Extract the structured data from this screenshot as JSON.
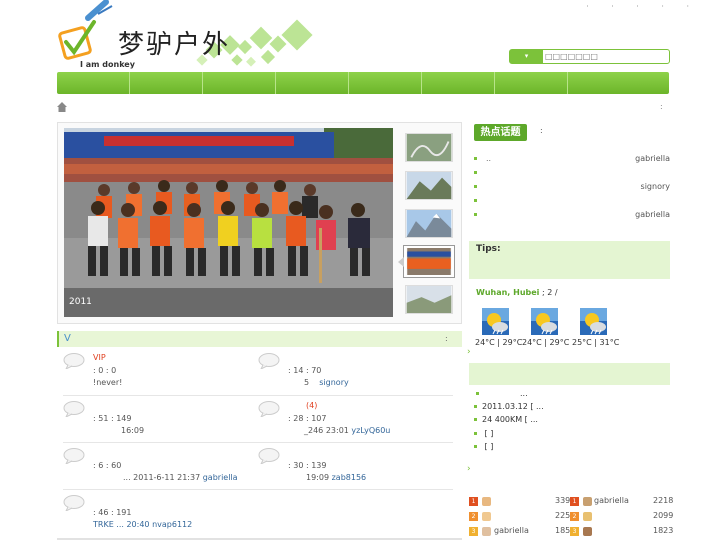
{
  "header": {
    "logo_en": "I am donkey",
    "logo_zh": "梦驴户外",
    "top_dots": "· · · · ·"
  },
  "search": {
    "button_label": "▾",
    "placeholder": "□□□□□□□"
  },
  "nav": {
    "items": [
      "",
      "",
      "",
      "",
      "",
      "",
      "",
      ""
    ]
  },
  "breadcrumb": {
    "right": ":"
  },
  "slideshow": {
    "caption": "2011",
    "thumb_count": 5,
    "active_thumb": 3
  },
  "forum": {
    "bar_left": "V",
    "bar_right": ":",
    "items": [
      {
        "title": "VIP",
        "stats": ": 0    : 0",
        "meta": "!never!",
        "meta_user": ""
      },
      {
        "title": "",
        "stats": ": 14    : 70",
        "meta": "5",
        "meta_user": "signory"
      },
      {
        "title": "",
        "stats": ": 51    : 149",
        "meta": "16:09",
        "meta_user": ""
      },
      {
        "title": "(4)",
        "stats": ": 28    : 107",
        "meta": "_246     23:01",
        "meta_user": "yzLyQ60u"
      },
      {
        "title": "",
        "stats": ": 6    : 60",
        "meta": "... 2011-6-11 21:37",
        "meta_user": "gabriella"
      },
      {
        "title": "",
        "stats": ": 30    : 139",
        "meta": "19:09",
        "meta_user": "zab8156"
      },
      {
        "title": "",
        "stats": ": 46    : 191",
        "meta": "TRKE              ...     20:40",
        "meta_user": "nvap6112"
      }
    ]
  },
  "hot": {
    "badge": "热点话题",
    "colon": ":",
    "items": [
      {
        "title": "..",
        "author": "gabriella"
      },
      {
        "title": "",
        "author": ""
      },
      {
        "title": "",
        "author": "signory"
      },
      {
        "title": "",
        "author": ""
      },
      {
        "title": "",
        "author": "gabriella"
      }
    ]
  },
  "tips": {
    "label": "Tips:"
  },
  "weather": {
    "city": "Wuhan, Hubei",
    "rest": ";        2 /",
    "days": [
      {
        "temp": "24°C | 29°C"
      },
      {
        "temp": "24°C | 29°C"
      },
      {
        "temp": "25°C | 31°C"
      }
    ]
  },
  "news": {
    "items": [
      "...",
      "2011.03.12        [ ...",
      "24      400KM      [ ...",
      "    [ ]",
      "        [ ]"
    ]
  },
  "ranking": {
    "rows": [
      {
        "left_num": "1",
        "left_name": "",
        "left_score": "339",
        "right_num": "1",
        "right_name": "gabriella",
        "right_score": "2218"
      },
      {
        "left_num": "2",
        "left_name": "",
        "left_score": "225",
        "right_num": "2",
        "right_name": "",
        "right_score": "2099"
      },
      {
        "left_num": "3",
        "left_name": "gabriella",
        "left_score": "185",
        "right_num": "3",
        "right_name": "",
        "right_score": "1823"
      }
    ]
  },
  "colors": {
    "accent": "#7cc23a",
    "accent_dark": "#5da82a",
    "light_green": "#e4f5d2",
    "link": "#336699",
    "red": "#e04020"
  }
}
